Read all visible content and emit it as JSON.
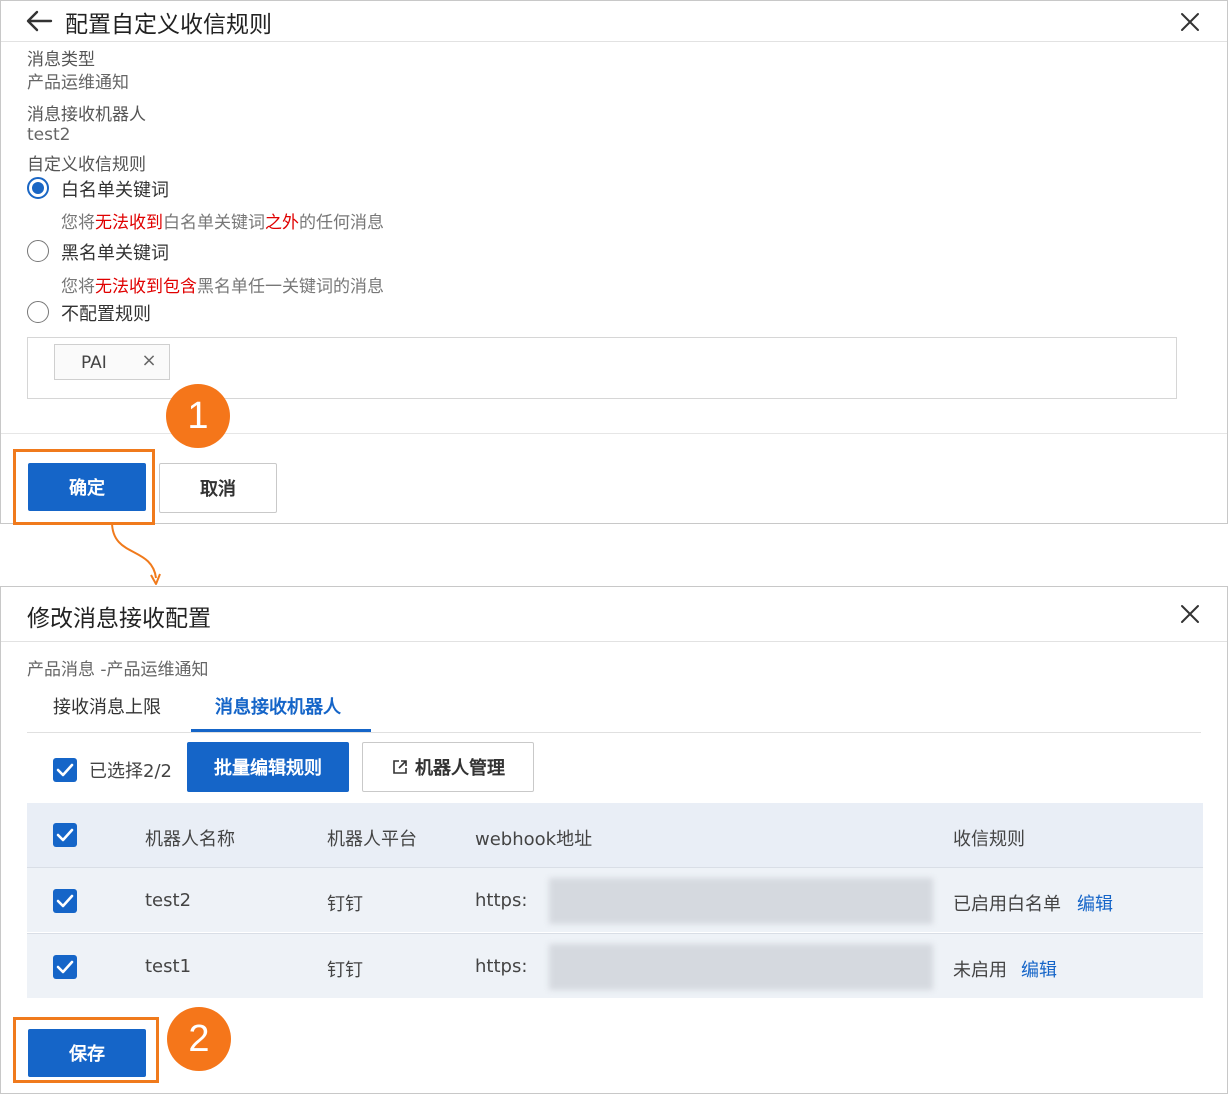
{
  "dialog1": {
    "title": "配置自定义收信规则",
    "msg_type_label": "消息类型",
    "msg_type_value": "产品运维通知",
    "robot_label": "消息接收机器人",
    "robot_value": "test2",
    "rule_label": "自定义收信规则",
    "options": [
      {
        "label": "白名单关键词",
        "selected": true,
        "desc_parts": [
          "您将",
          "无法收到",
          "白名单关键词",
          "之外",
          "的任何消息"
        ]
      },
      {
        "label": "黑名单关键词",
        "selected": false,
        "desc_parts": [
          "您将",
          "无法收到包含",
          "黑名单任一关键词的消息"
        ]
      },
      {
        "label": "不配置规则",
        "selected": false
      }
    ],
    "keyword_tag": "PAI",
    "tag_remove": "×",
    "confirm_label": "确定",
    "cancel_label": "取消"
  },
  "dialog2": {
    "title": "修改消息接收配置",
    "subtitle": "产品消息 -产品运维通知",
    "tabs": [
      "接收消息上限",
      "消息接收机器人"
    ],
    "active_tab": 1,
    "selected_count": "已选择2/2",
    "batch_edit_label": "批量编辑规则",
    "robot_manage_label": "机器人管理",
    "table": {
      "headers": [
        "机器人名称",
        "机器人平台",
        "webhook地址",
        "收信规则"
      ],
      "rows": [
        {
          "name": "test2",
          "platform": "钉钉",
          "webhook": "https:",
          "rule": "已启用白名单",
          "action": "编辑",
          "checked": true
        },
        {
          "name": "test1",
          "platform": "钉钉",
          "webhook": "https:",
          "rule": "未启用",
          "action": "编辑",
          "checked": true
        }
      ]
    },
    "save_label": "保存"
  },
  "markers": [
    "1",
    "2"
  ],
  "colors": {
    "primary": "#1565c8",
    "highlight": "#f07a1c",
    "marker": "#f5761a",
    "warning_text": "#e00000"
  },
  "icons": {
    "back": "arrow-left-icon",
    "close": "close-icon",
    "external": "external-link-icon",
    "check": "check-icon"
  }
}
